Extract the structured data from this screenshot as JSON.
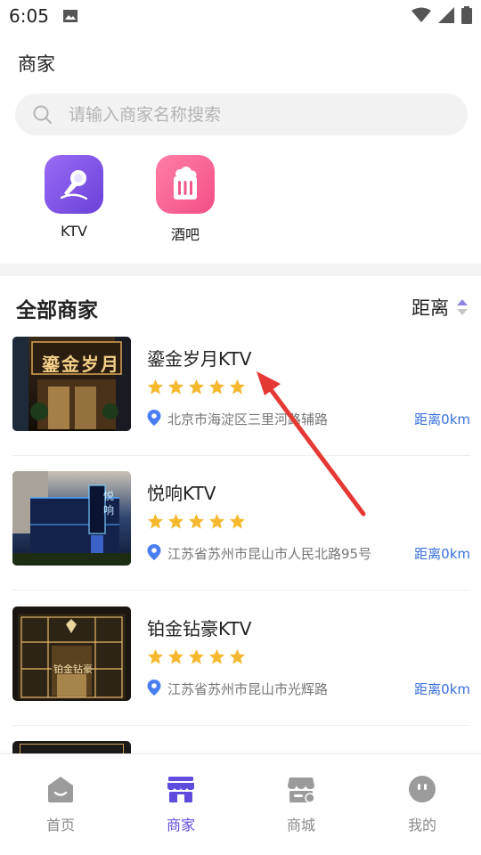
{
  "status_bar": {
    "time": "6:05"
  },
  "header": {
    "title": "商家"
  },
  "search": {
    "placeholder": "请输入商家名称搜索",
    "value": ""
  },
  "categories": [
    {
      "label": "KTV",
      "icon": "microphone-icon",
      "color": "#7b52e6"
    },
    {
      "label": "酒吧",
      "icon": "beer-mug-icon",
      "color": "#f2578b"
    }
  ],
  "list": {
    "title": "全部商家",
    "sort_label": "距离",
    "merchants": [
      {
        "name": "鎏金岁月KTV",
        "rating": 5,
        "address": "北京市海淀区三里河路辅路",
        "distance": "距离0km",
        "sign_text": "鎏金岁月",
        "image_tone": "warm"
      },
      {
        "name": "悦响KTV",
        "rating": 5,
        "address": "江苏省苏州市昆山市人民北路95号",
        "distance": "距离0km",
        "sign_text": "悦响",
        "image_tone": "blue"
      },
      {
        "name": "铂金钻豪KTV",
        "rating": 5,
        "address": "江苏省苏州市昆山市光辉路",
        "distance": "距离0km",
        "sign_text": "铂金钻豪",
        "image_tone": "gold"
      }
    ]
  },
  "bottom_nav": [
    {
      "label": "首页",
      "icon": "home-icon",
      "active": false
    },
    {
      "label": "商家",
      "icon": "store-icon",
      "active": true
    },
    {
      "label": "商城",
      "icon": "shop-icon",
      "active": false
    },
    {
      "label": "我的",
      "icon": "profile-icon",
      "active": false
    }
  ],
  "colors": {
    "accent": "#5d4cdd",
    "star": "#f5b82e",
    "distance": "#3a6fdc",
    "arrow": "#e53935"
  }
}
